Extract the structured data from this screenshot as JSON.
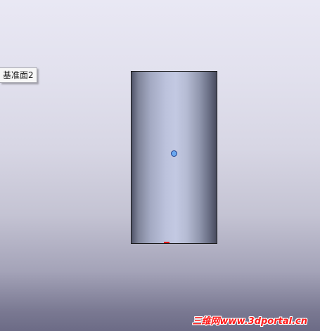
{
  "viewport": {
    "plane_label": "基准面2",
    "watermark": "三维网www.3dportal.cn"
  },
  "colors": {
    "origin_point": "#6aa8f0",
    "marker": "#e01818",
    "watermark": "#ff1a1a"
  }
}
